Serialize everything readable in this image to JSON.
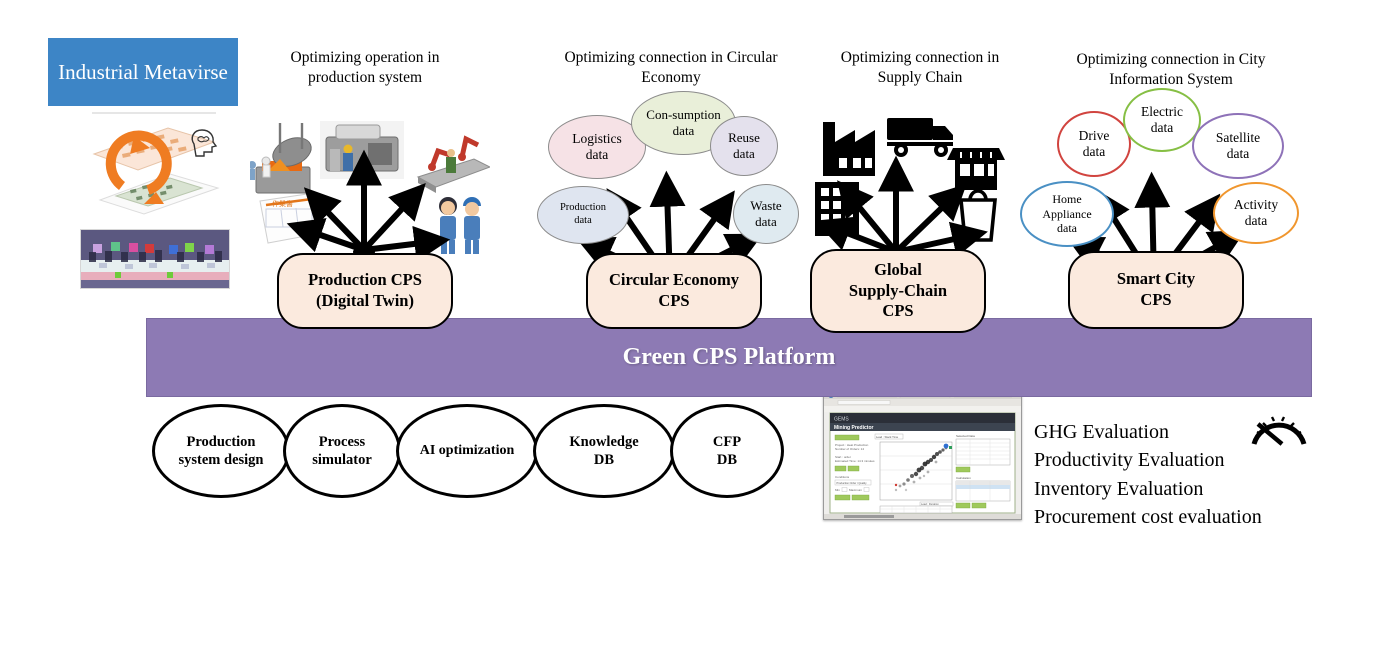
{
  "metaverse": {
    "title": "Industrial Metavirse",
    "layout_image_name": "factory-layout-digital-twin-image",
    "simulation_image_name": "3d-factory-simulation-image"
  },
  "sections": [
    {
      "id": "production",
      "caption": "Optimizing operation in production system",
      "cps_label": "Production CPS\n(Digital Twin)",
      "cps_line1": "Production CPS",
      "cps_line2": "(Digital Twin)",
      "nodes": [
        {
          "label": "casting-furnace-icon"
        },
        {
          "label": "machine-tool-icon"
        },
        {
          "label": "robot-assembly-line-icon"
        },
        {
          "label": "work-instruction-document-icon"
        },
        {
          "label": "factory-workers-icon"
        }
      ]
    },
    {
      "id": "circular-economy",
      "caption": "Optimizing connection in Circular Economy",
      "cps_line1": "Circular Economy",
      "cps_line2": "CPS",
      "nodes": [
        {
          "label": "Logistics\ndata",
          "l1": "Logistics",
          "l2": "data",
          "fill": "#f6e2e6",
          "stroke": "#8c8c8c"
        },
        {
          "label": "Con-sumption\ndata",
          "l1": "Con-sumption",
          "l2": "data",
          "fill": "#e9efd9",
          "stroke": "#8c8c8c"
        },
        {
          "label": "Reuse\ndata",
          "l1": "Reuse",
          "l2": "data",
          "fill": "#e4e1ed",
          "stroke": "#8c8c8c"
        },
        {
          "label": "Production\ndata",
          "l1": "Production",
          "l2": "data",
          "fill": "#dfe5f0",
          "stroke": "#8c8c8c"
        },
        {
          "label": "Waste\ndata",
          "l1": "Waste",
          "l2": "data",
          "fill": "#dfeaf0",
          "stroke": "#8c8c8c"
        }
      ]
    },
    {
      "id": "supply-chain",
      "caption": "Optimizing connection in Supply Chain",
      "cps_line1": "Global",
      "cps_line2": "Supply-Chain",
      "cps_line3": "CPS",
      "nodes": [
        {
          "label": "factory-icon"
        },
        {
          "label": "delivery-truck-icon"
        },
        {
          "label": "retail-store-icon"
        },
        {
          "label": "office-building-icon"
        },
        {
          "label": "shopping-bag-icon"
        }
      ]
    },
    {
      "id": "smart-city",
      "caption": "Optimizing connection in City Information System",
      "cps_line1": "Smart City",
      "cps_line2": "CPS",
      "nodes": [
        {
          "label": "Drive\ndata",
          "l1": "Drive",
          "l2": "data",
          "fill": "#ffffff",
          "stroke": "#d1443f"
        },
        {
          "label": "Electric\ndata",
          "l1": "Electric",
          "l2": "data",
          "fill": "#ffffff",
          "stroke": "#86bf44"
        },
        {
          "label": "Satellite\ndata",
          "l1": "Satellite",
          "l2": "data",
          "fill": "#ffffff",
          "stroke": "#8e72b8"
        },
        {
          "label": "Home Appliance\ndata",
          "l1": "Home",
          "l2": "Appliance",
          "l3": "data",
          "fill": "#ffffff",
          "stroke": "#4a90c4"
        },
        {
          "label": "Activity\ndata",
          "l1": "Activity",
          "l2": "data",
          "fill": "#ffffff",
          "stroke": "#f0962e"
        }
      ]
    }
  ],
  "platform": {
    "label": "Green CPS Platform",
    "color": "#8d7ab4"
  },
  "capabilities": [
    {
      "l1": "Production",
      "l2": "system design"
    },
    {
      "l1": "Process",
      "l2": "simulator"
    },
    {
      "l1": "AI optimization",
      "l2": ""
    },
    {
      "l1": "Knowledge",
      "l2": "DB"
    },
    {
      "l1": "CFP",
      "l2": "DB"
    }
  ],
  "app_screenshot": {
    "name": "mining-predictor-app-screenshot",
    "app_title": "GEMS",
    "header_title": "Mining Predictor"
  },
  "evaluations": [
    "GHG Evaluation",
    "Productivity Evaluation",
    "Inventory Evaluation",
    "Procurement cost evaluation"
  ],
  "gauge_icon": "speedometer-icon"
}
